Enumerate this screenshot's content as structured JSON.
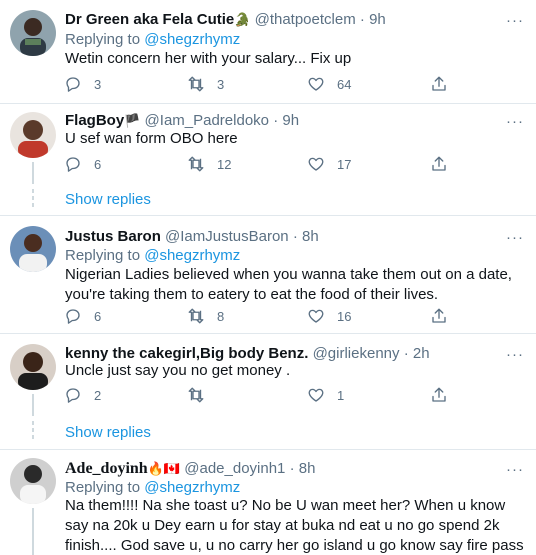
{
  "tweets": [
    {
      "name": "Dr Green aka Fela Cutie",
      "badge": "🐊",
      "handle": "@thatpoetclem",
      "time": "9h",
      "replying_label": "Replying to",
      "replying_to": "@shegzrhymz",
      "text": "Wetin concern her with your salary... Fix up",
      "replies": "3",
      "retweets": "3",
      "likes": "64"
    },
    {
      "name": "FlagBoy",
      "badge": "🏴",
      "handle": "@Iam_Padreldoko",
      "time": "9h",
      "text": "U sef wan form OBO here",
      "replies": "6",
      "retweets": "12",
      "likes": "17"
    },
    {
      "name": "Justus Baron",
      "handle": "@IamJustusBaron",
      "time": "8h",
      "replying_label": "Replying to",
      "replying_to": "@shegzrhymz",
      "text": "Nigerian Ladies believed when you wanna take them out on a date,  you're taking them to eatery to eat the food of their lives.",
      "replies": "6",
      "retweets": "8",
      "likes": "16"
    },
    {
      "name": "kenny the cakegirl,Big body Benz.",
      "handle": "@girliekenny",
      "time": "2h",
      "text": "Uncle just say you no get money .",
      "replies": "2",
      "retweets": "",
      "likes": "1"
    },
    {
      "name": "Ade_doyinh",
      "badge": "🔥🇨🇦",
      "handle": "@ade_doyinh1",
      "time": "8h",
      "replying_label": "Replying to",
      "replying_to": "@shegzrhymz",
      "text": "Na them!!!! Na she toast u? No be U wan meet her? When u know say na 20k u Dey earn u for stay at buka nd eat u no go spend 2k finish.... God save u, u no carry her go island u go know say fire pass fire"
    }
  ],
  "show_replies_label": "Show replies",
  "dot": "·",
  "more_label": "···",
  "colors": {
    "accent": "#1b95e0",
    "muted": "#5b7083",
    "divider": "#e1e8ed"
  },
  "icons": [
    "reply-icon",
    "retweet-icon",
    "like-icon",
    "share-icon",
    "more-icon",
    "avatar"
  ]
}
